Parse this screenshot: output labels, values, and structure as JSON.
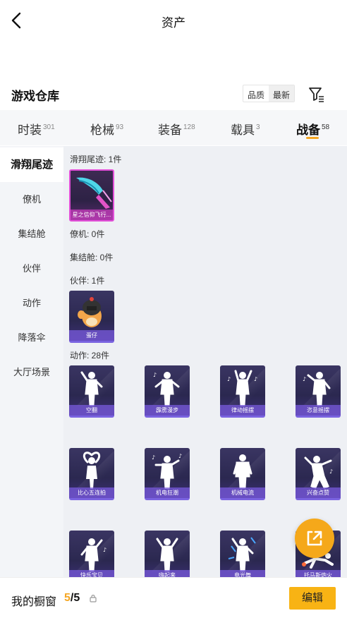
{
  "header": {
    "title": "资产"
  },
  "section": {
    "title": "游戏仓库"
  },
  "sort": {
    "quality": "品质",
    "latest": "最新"
  },
  "tabs": [
    {
      "label": "时装",
      "count": "301"
    },
    {
      "label": "枪械",
      "count": "93"
    },
    {
      "label": "装备",
      "count": "128"
    },
    {
      "label": "载具",
      "count": "3"
    },
    {
      "label": "战备",
      "count": "58"
    }
  ],
  "sidebar": [
    {
      "label": "滑翔尾迹"
    },
    {
      "label": "僚机"
    },
    {
      "label": "集结舱"
    },
    {
      "label": "伙伴"
    },
    {
      "label": "动作"
    },
    {
      "label": "降落伞"
    },
    {
      "label": "大厅场景"
    }
  ],
  "groups": {
    "glide": {
      "label": "滑翔尾迹: 1件",
      "items": [
        {
          "name": "星之信仰飞行..."
        }
      ]
    },
    "wingman": {
      "label": "僚机: 0件"
    },
    "pod": {
      "label": "集结舱: 0件"
    },
    "partner": {
      "label": "伙伴: 1件",
      "items": [
        {
          "name": "蛋仔"
        }
      ]
    },
    "emote": {
      "label": "动作: 28件",
      "items": [
        {
          "name": "空翻"
        },
        {
          "name": "霹雳漫步"
        },
        {
          "name": "律动摇摆"
        },
        {
          "name": "恣意摇摆"
        },
        {
          "name": "比心五连拍"
        },
        {
          "name": "机电狂潮"
        },
        {
          "name": "机械电流"
        },
        {
          "name": "兴奋点赞"
        },
        {
          "name": "快乐宝贝"
        },
        {
          "name": "嗨起来"
        },
        {
          "name": "电光舞"
        },
        {
          "name": "托马斯炮火"
        }
      ]
    }
  },
  "showcase": {
    "label": "我的橱窗",
    "current": "5",
    "total": "/5"
  },
  "edit_label": "编辑",
  "colors": {
    "accent": "#f5a623",
    "card_purple": "#2b2850",
    "card_highlight": "#e24fd8",
    "share": "#f5a81a"
  }
}
